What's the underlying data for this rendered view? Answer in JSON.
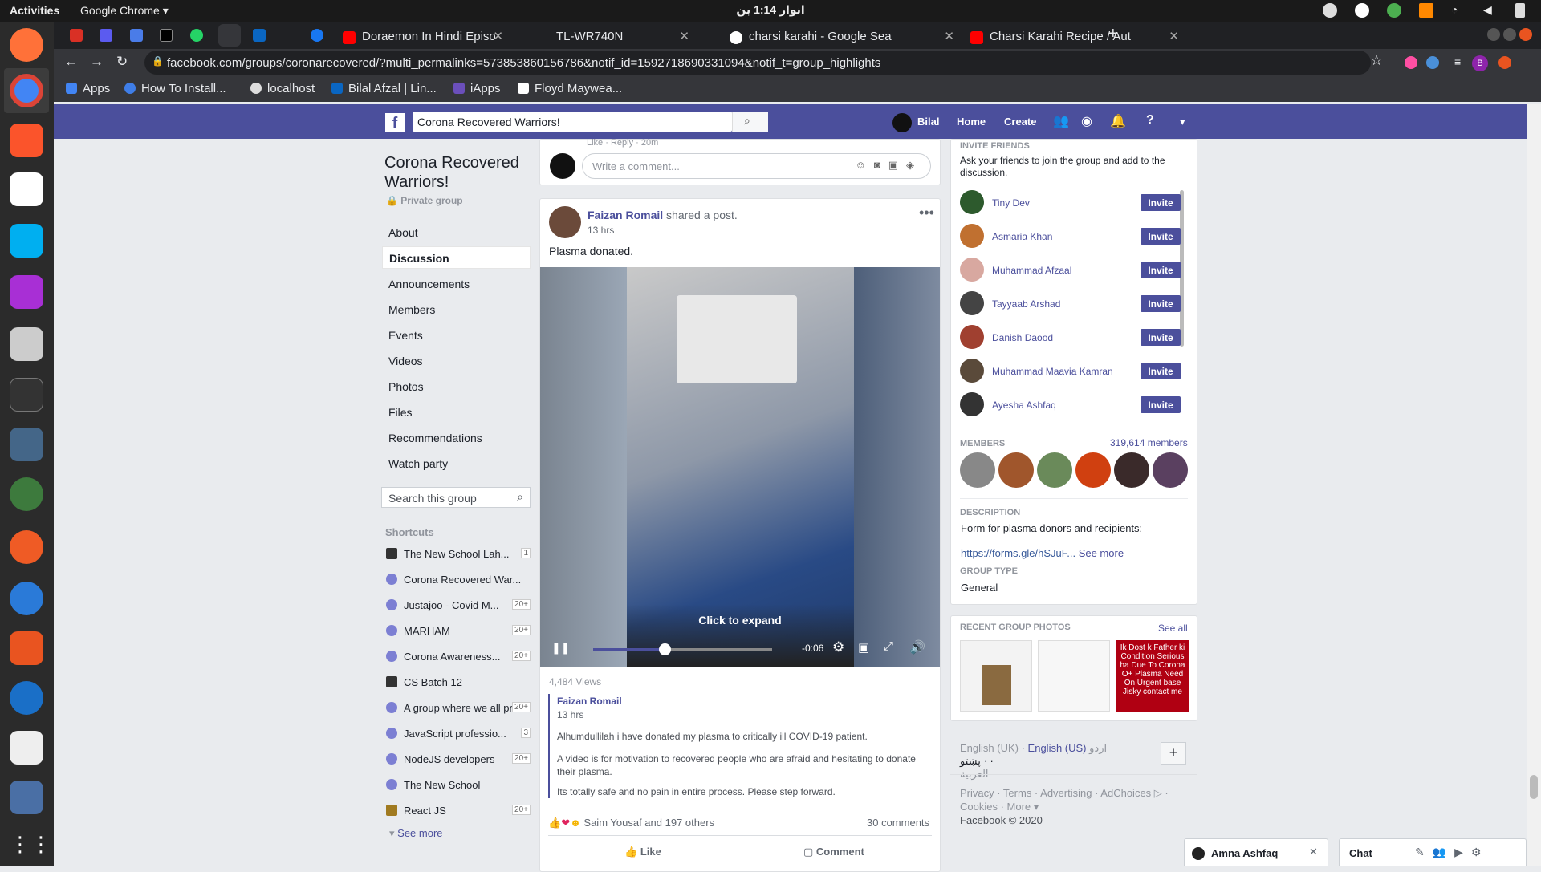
{
  "system": {
    "activities": "Activities",
    "app_menu": "Google Chrome",
    "clock": "انوار 1:14 بن"
  },
  "tabs": [
    {
      "label": "Doraemon In Hindi Episo",
      "color": "#ff0000"
    },
    {
      "label": "TL-WR740N",
      "color": "#444"
    },
    {
      "label": "charsi karahi - Google Sea",
      "color": "#4285f4"
    },
    {
      "label": "Charsi Karahi Recipe / Aut",
      "color": "#ff0000"
    }
  ],
  "address": "facebook.com/groups/coronarecovered/?multi_permalinks=573853860156786&notif_id=1592718690331094&notif_t=group_highlights",
  "bookmarks": [
    "Apps",
    "How To Install...",
    "localhost",
    "Bilal Afzal | Lin...",
    "iApps",
    "Floyd Maywea..."
  ],
  "fb": {
    "search_value": "Corona Recovered Warriors!",
    "user": "Bilal",
    "home": "Home",
    "create": "Create"
  },
  "group": {
    "name_line1": "Corona Recovered",
    "name_line2": "Warriors!",
    "privacy": "Private group",
    "nav": [
      "About",
      "Discussion",
      "Announcements",
      "Members",
      "Events",
      "Videos",
      "Photos",
      "Files",
      "Recommendations",
      "Watch party"
    ],
    "search_placeholder": "Search this group"
  },
  "shortcuts": {
    "title": "Shortcuts",
    "items": [
      {
        "label": "The New School Lah...",
        "count": "1"
      },
      {
        "label": "Corona Recovered War...",
        "count": ""
      },
      {
        "label": "Justajoo - Covid M...",
        "count": "20+"
      },
      {
        "label": "MARHAM",
        "count": "20+"
      },
      {
        "label": "Corona Awareness...",
        "count": "20+"
      },
      {
        "label": "CS Batch 12",
        "count": ""
      },
      {
        "label": "A group where we all pr...",
        "count": "20+"
      },
      {
        "label": "JavaScript professio...",
        "count": "3"
      },
      {
        "label": "NodeJS developers",
        "count": "20+"
      },
      {
        "label": "The New School",
        "count": ""
      },
      {
        "label": "React JS",
        "count": "20+"
      }
    ],
    "see_more": "See more"
  },
  "comment": {
    "top_partial": "Like · Reply · 20m",
    "placeholder": "Write a comment..."
  },
  "post": {
    "author": "Faizan Romail",
    "action": "shared a post.",
    "time": "13 hrs",
    "text": "Plasma donated.",
    "video": {
      "overlay": "Click to expand",
      "time_remaining": "-0:06",
      "progress": 0.4
    },
    "views": "4,484 Views",
    "shared": {
      "author": "Faizan Romail",
      "time": "13 hrs",
      "p1": "Alhumdullilah i have donated my plasma to critically ill COVID-19 patient.",
      "p2": "A video is for motivation to recovered people who are afraid and hesitating to donate their plasma.",
      "p3": "Its totally safe and no pain in entire process. Please step forward."
    },
    "reactions": "Saim Yousaf and 197 others",
    "comments": "30 comments",
    "like": "Like",
    "comment_btn": "Comment"
  },
  "sidebar": {
    "invite_title": "INVITE FRIENDS",
    "invite_desc": "Ask your friends to join the group and add to the discussion.",
    "invite_label": "Invite",
    "friends": [
      "Tiny Dev",
      "Asmaria Khan",
      "Muhammad Afzaal",
      "Tayyaab Arshad",
      "Danish Daood",
      "Muhammad Maavia Kamran",
      "Ayesha Ashfaq"
    ],
    "members_title": "MEMBERS",
    "members_count": "319,614 members",
    "desc_title": "DESCRIPTION",
    "desc": "Form for plasma donors and recipients:",
    "desc_link": "https://forms.gle/hSJuF...",
    "see_more": "See more",
    "type_title": "GROUP TYPE",
    "type": "General",
    "photos_title": "RECENT GROUP PHOTOS",
    "see_all": "See all",
    "photo3_text": "Ik Dost k Father ki Condition Serious ha Due To Corona O+ Plasma Need On Urgent base Jisky contact me"
  },
  "langs": {
    "uk": "English (UK) ·",
    "us": "English (US)",
    "ur": "اردو ·",
    "ps": "پښتو ·",
    "ar": "العربية"
  },
  "footer": {
    "line1": "Privacy · Terms · Advertising · AdChoices ▷ ·",
    "line2": "Cookies · More ▾",
    "copy": "Facebook © 2020"
  },
  "chat": {
    "tab1": "Amna Ashfaq",
    "tab2": "Chat"
  }
}
